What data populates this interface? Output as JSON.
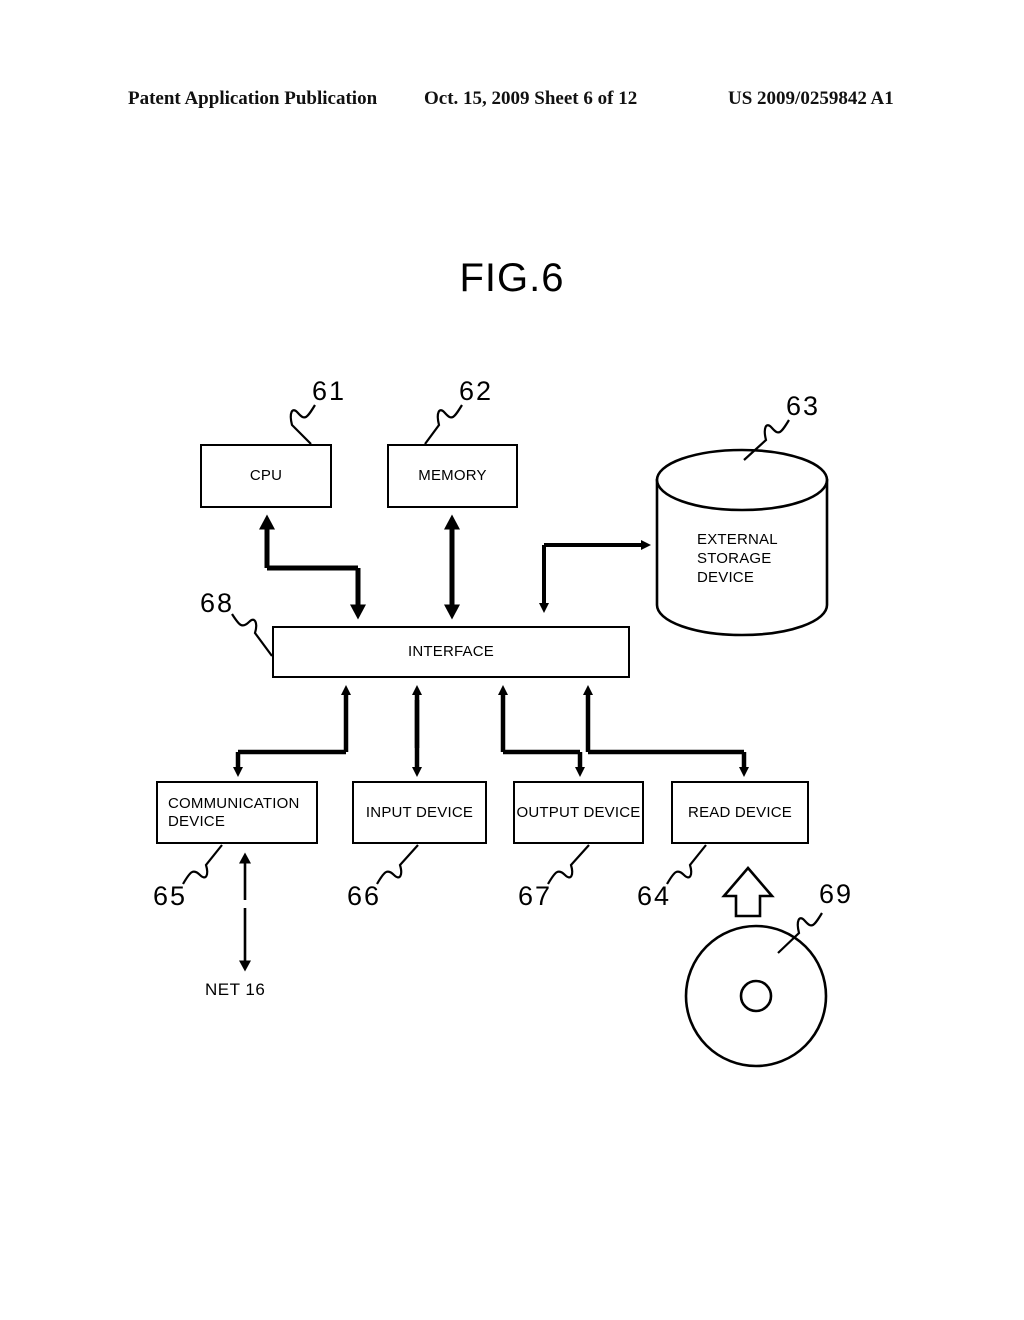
{
  "header": {
    "left": "Patent Application Publication",
    "middle": "Oct. 15, 2009  Sheet 6 of 12",
    "right": "US 2009/0259842 A1"
  },
  "figure": {
    "title": "FIG.6"
  },
  "blocks": {
    "cpu": {
      "label": "CPU",
      "ref": "61"
    },
    "memory": {
      "label": "MEMORY",
      "ref": "62"
    },
    "external_storage": {
      "label": "EXTERNAL\nSTORAGE\nDEVICE",
      "ref": "63"
    },
    "interface": {
      "label": "INTERFACE",
      "ref": "68"
    },
    "communication_device": {
      "label": "COMMUNICATION\nDEVICE",
      "ref": "65"
    },
    "input_device": {
      "label": "INPUT DEVICE",
      "ref": "66"
    },
    "output_device": {
      "label": "OUTPUT DEVICE",
      "ref": "67"
    },
    "read_device": {
      "label": "READ DEVICE",
      "ref": "64"
    },
    "recording_medium": {
      "label": "",
      "ref": "69"
    }
  },
  "labels": {
    "net": "NET  16"
  },
  "colors": {
    "ink": "#000000",
    "paper": "#ffffff"
  }
}
